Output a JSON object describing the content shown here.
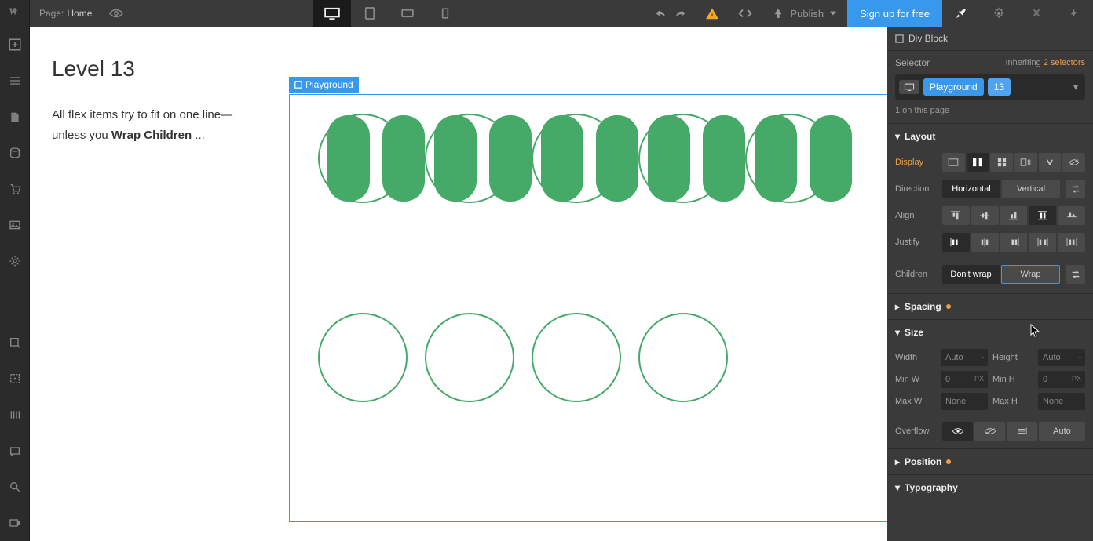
{
  "topbar": {
    "page_label": "Page:",
    "page_name": "Home",
    "publish": "Publish",
    "signup": "Sign up for free"
  },
  "breadcrumb": {
    "type": "Div Block"
  },
  "selector": {
    "label": "Selector",
    "inheriting_prefix": "Inheriting",
    "inheriting_link": "2 selectors",
    "chip1": "Playground",
    "chip2": "13",
    "hint": "1 on this page"
  },
  "sections": {
    "layout": "Layout",
    "spacing": "Spacing",
    "size": "Size",
    "position": "Position",
    "typography": "Typography"
  },
  "layout": {
    "display_label": "Display",
    "direction_label": "Direction",
    "direction_h": "Horizontal",
    "direction_v": "Vertical",
    "align_label": "Align",
    "justify_label": "Justify",
    "children_label": "Children",
    "children_nowrap": "Don't wrap",
    "children_wrap": "Wrap"
  },
  "size": {
    "width_label": "Width",
    "width_val": "Auto",
    "height_label": "Height",
    "height_val": "Auto",
    "minw_label": "Min W",
    "minw_val": "0",
    "minw_unit": "PX",
    "minh_label": "Min H",
    "minh_val": "0",
    "minh_unit": "PX",
    "maxw_label": "Max W",
    "maxw_val": "None",
    "maxh_label": "Max H",
    "maxh_val": "None",
    "overflow_label": "Overflow",
    "overflow_auto": "Auto"
  },
  "canvas": {
    "title": "Level 13",
    "desc_before": "All flex items try to fit on one line—unless you ",
    "desc_strong": "Wrap Children",
    "desc_after": " ...",
    "tag": "Playground"
  }
}
